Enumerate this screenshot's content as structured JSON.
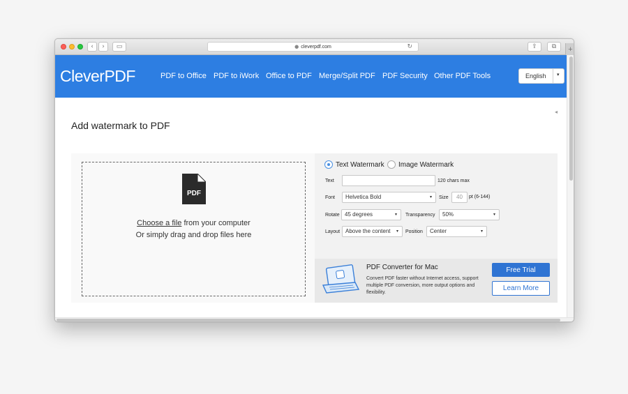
{
  "browser": {
    "address": "cleverpdf.com",
    "icons": [
      "back-icon",
      "forward-icon",
      "sidebar-icon",
      "lock-icon",
      "reload-icon",
      "share-icon",
      "tabs-icon",
      "new-tab-icon"
    ],
    "glyphs": {
      "back": "‹",
      "forward": "›",
      "sidebar": "▭",
      "lock": "🔒",
      "reload": "↻",
      "share": "⇪",
      "tabs": "⧉",
      "new_tab": "+"
    }
  },
  "nav": {
    "logo": "CleverPDF",
    "items": [
      "PDF to Office",
      "PDF to iWork",
      "Office to PDF",
      "Merge/Split PDF",
      "PDF Security",
      "Other PDF Tools"
    ],
    "language": "English",
    "colors": {
      "bar": "#2d7ee2"
    }
  },
  "page": {
    "title": "Add watermark to PDF",
    "collapse_glyph": "◂"
  },
  "upload": {
    "icon_label": "PDF",
    "choose_link": "Choose a file",
    "choose_rest": " from your computer",
    "drag_text": "Or simply drag and drop files here"
  },
  "options": {
    "tabs": {
      "text": "Text Watermark",
      "image": "Image Watermark",
      "selected": "Text Watermark"
    },
    "text_label": "Text",
    "text_value": "",
    "text_hint": "120 chars max",
    "font_label": "Font",
    "font_value": "Helvetica Bold",
    "size_label": "Size",
    "size_placeholder": "40",
    "size_hint": "pt (6-144)",
    "rotate_label": "Rotate",
    "rotate_value": "45 degrees",
    "transparency_label": "Transparency",
    "transparency_value": "50%",
    "layout_label": "Layout",
    "layout_value": "Above the content",
    "position_label": "Position",
    "position_value": "Center",
    "dropdown_glyph": "▾"
  },
  "ad": {
    "title": "PDF Converter for Mac",
    "description": "Convert PDF faster without Internet access, support multiple PDF conversion, more output options and flexibility.",
    "trial_button": "Free Trial",
    "learn_button": "Learn More",
    "colors": {
      "button": "#2f74d3"
    }
  }
}
